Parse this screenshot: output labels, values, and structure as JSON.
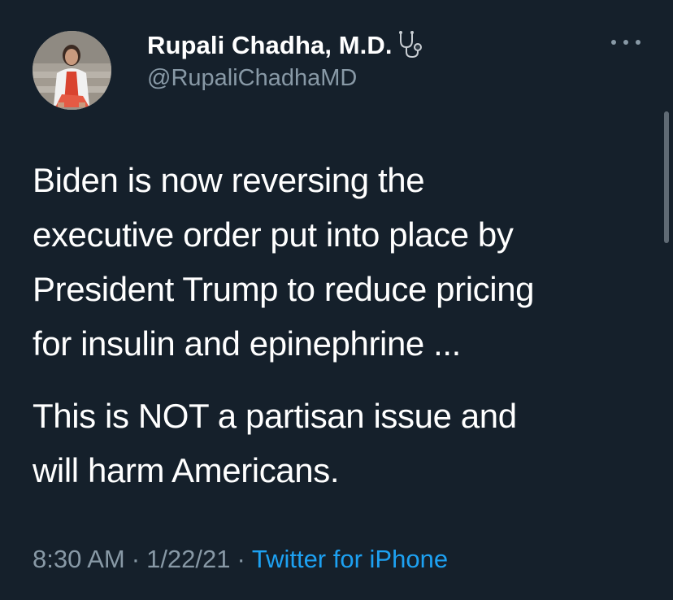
{
  "tweet": {
    "author": {
      "display_name": "Rupali Chadha, M.D.",
      "handle": "@RupaliChadhaMD",
      "name_emoji_icon": "stethoscope-icon",
      "avatar_icon": "profile-photo"
    },
    "more_icon": "more-options-icon",
    "paragraphs": [
      "Biden is now reversing the\nexecutive order put into place by\nPresident Trump to reduce pricing\nfor insulin and epinephrine ...",
      "This is NOT a partisan issue and\nwill harm Americans."
    ],
    "time": "8:30 AM",
    "separator": "·",
    "date": "1/22/21",
    "source": "Twitter for iPhone"
  },
  "colors": {
    "background": "#15202b",
    "primary_text": "#ffffff",
    "secondary_text": "#8899a6",
    "link": "#1da1f2"
  }
}
